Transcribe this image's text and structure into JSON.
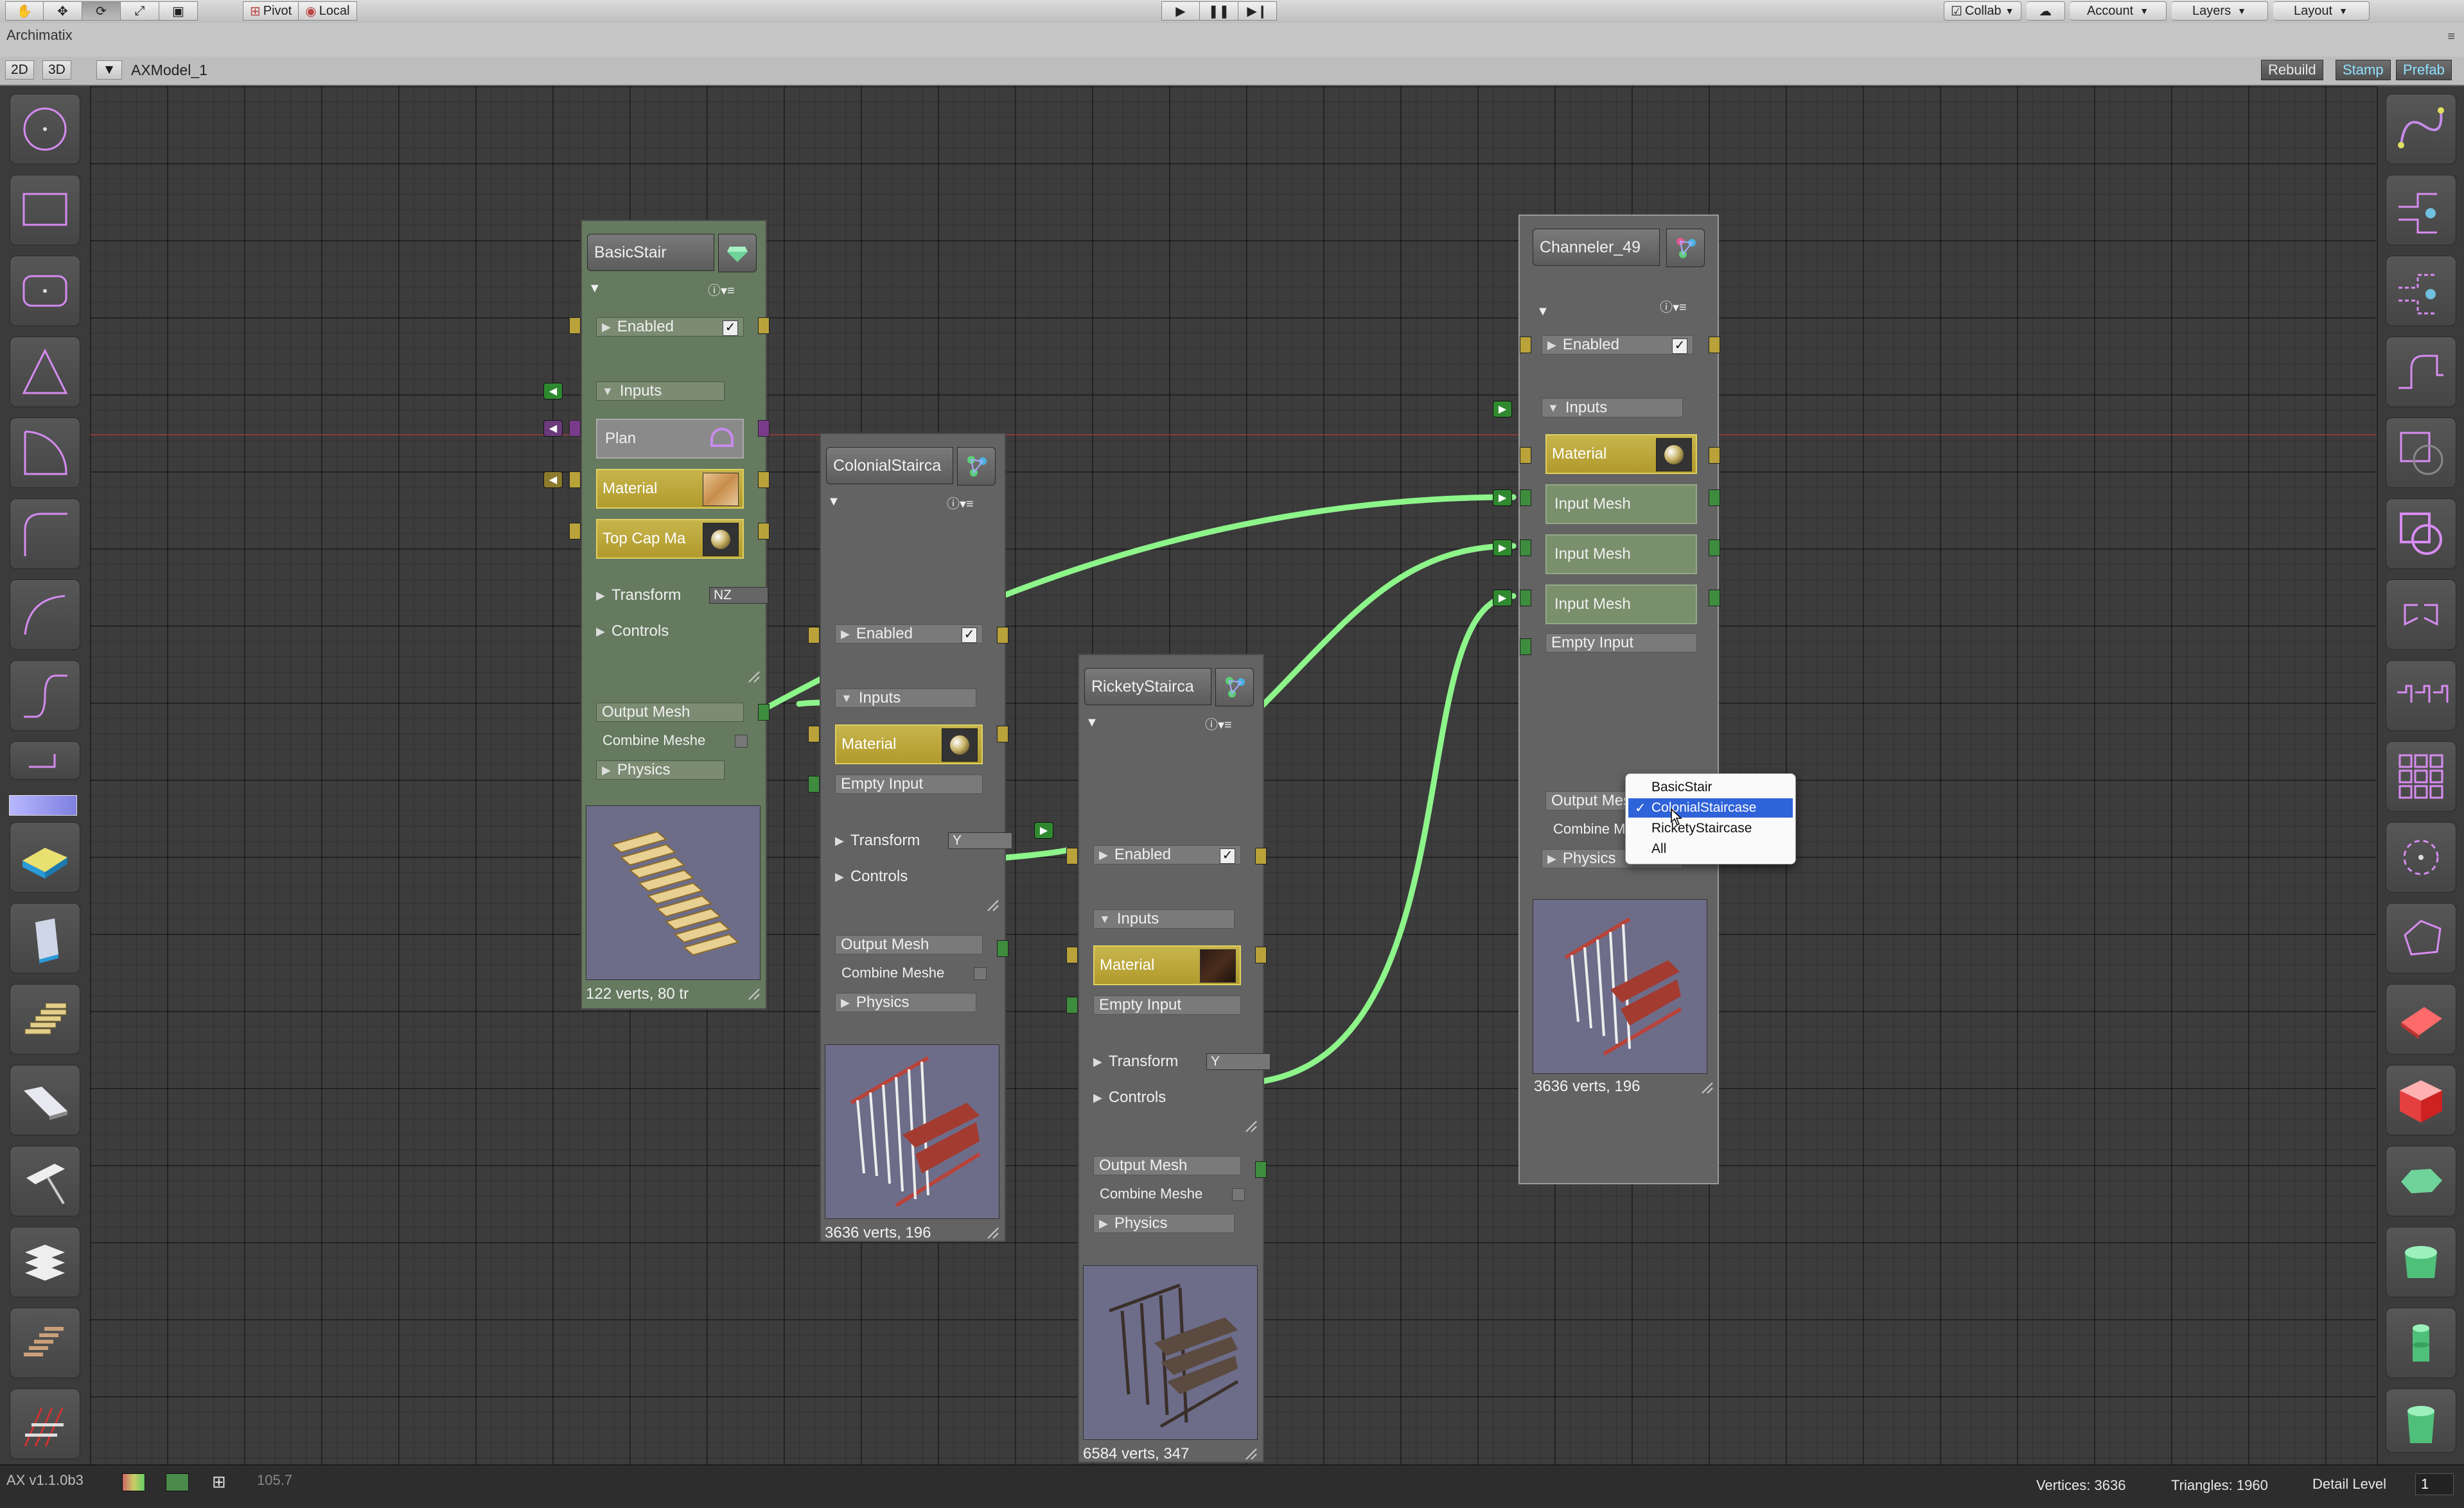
{
  "toolbar": {
    "tools": [
      "hand-icon",
      "move-icon",
      "rotate-icon",
      "scale-icon",
      "rect-icon"
    ],
    "pivot_label": "Pivot",
    "local_label": "Local",
    "collab_label": "Collab",
    "account_label": "Account",
    "layers_label": "Layers",
    "layout_label": "Layout"
  },
  "window": {
    "title": "Archimatix"
  },
  "subbar": {
    "btn_2d": "2D",
    "btn_3d": "3D",
    "model_name": "AXModel_1",
    "rebuild": "Rebuild",
    "stamp": "Stamp",
    "prefab": "Prefab"
  },
  "nodes": {
    "basic": {
      "title": "BasicStair",
      "enabled": "Enabled",
      "inputs": "Inputs",
      "plan": "Plan",
      "material": "Material",
      "topcap": "Top Cap Ma",
      "transform": "Transform",
      "transform_val": "NZ",
      "controls": "Controls",
      "output": "Output Mesh",
      "combine": "Combine Meshe",
      "physics": "Physics",
      "stats": "122 verts, 80 tr"
    },
    "colonial": {
      "title": "ColonialStairca",
      "enabled": "Enabled",
      "inputs": "Inputs",
      "material": "Material",
      "empty": "Empty Input",
      "transform": "Transform",
      "transform_val": "Y",
      "controls": "Controls",
      "output": "Output Mesh",
      "combine": "Combine Meshe",
      "physics": "Physics",
      "stats": "3636 verts, 196"
    },
    "rickety": {
      "title": "RicketyStairca",
      "enabled": "Enabled",
      "inputs": "Inputs",
      "material": "Material",
      "empty": "Empty Input",
      "transform": "Transform",
      "transform_val": "Y",
      "controls": "Controls",
      "output": "Output Mesh",
      "combine": "Combine Meshe",
      "physics": "Physics",
      "stats": "6584 verts, 347"
    },
    "channeler": {
      "title": "Channeler_49",
      "enabled": "Enabled",
      "inputs": "Inputs",
      "material": "Material",
      "input_mesh_1": "Input Mesh",
      "input_mesh_2": "Input Mesh",
      "input_mesh_3": "Input Mesh",
      "empty": "Empty Input",
      "output": "Output Mesh",
      "combine": "Combine Meshe",
      "physics": "Physics",
      "stats": "3636 verts, 196"
    }
  },
  "popup": {
    "options": [
      "BasicStair",
      "ColonialStaircase",
      "RicketyStaircase",
      "All"
    ],
    "selected": "ColonialStaircase"
  },
  "status": {
    "version": "AX v1.1.0b3",
    "zoom": "105.7",
    "vertices": "Vertices: 3636",
    "triangles": "Triangles: 1960",
    "detail_label": "Detail Level",
    "detail_value": "1"
  },
  "colors": {
    "wire": "#8df58a",
    "material_yellow": "#c0ac44",
    "node_green": "#657a5f",
    "selection_blue": "#2f63d9"
  }
}
